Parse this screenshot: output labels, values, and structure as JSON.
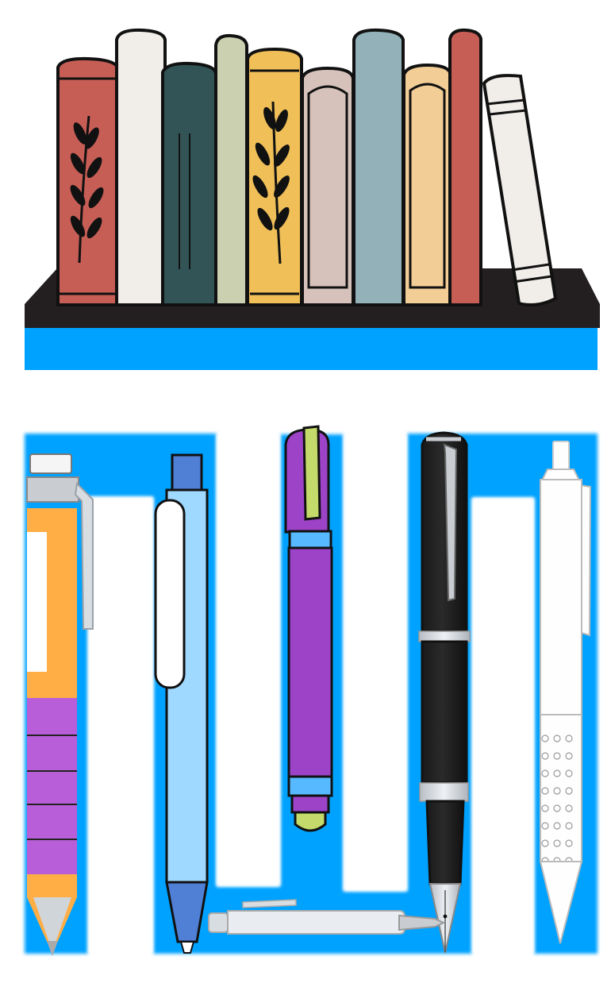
{
  "scene": {
    "top_panel": "bookshelf-scene",
    "bottom_panel": "pen-maze-scene"
  },
  "colors": {
    "background": "#ffffff",
    "accent_blue": "#00a2ff",
    "shelf_top": "#231f20",
    "outline": "#111111",
    "book_red": "#c75e56",
    "book_white": "#f1eeea",
    "book_teal": "#325457",
    "book_sage": "#cad0b0",
    "book_yellow": "#f0bf58",
    "book_pink": "#d7c2bb",
    "book_slateblue": "#92b1b8",
    "book_peach": "#f3cd96",
    "pen_orange": "#ffae45",
    "pen_purple": "#b85ed8",
    "pen_light_blue": "#9fd9ff",
    "pen_mid_blue": "#4f80d6",
    "pen_violet": "#9c43c7",
    "pen_lime": "#c4da6a",
    "pen_black": "#161616",
    "metal_gray": "#c9cdd2",
    "white_pen": "#fefefe"
  },
  "icons": [
    "bookshelf-icon",
    "book-icon",
    "leaf-branch-icon",
    "mechanical-pencil-icon",
    "ballpoint-pen-icon",
    "marker-pen-icon",
    "fountain-pen-icon",
    "click-pen-icon",
    "small-pen-icon"
  ]
}
